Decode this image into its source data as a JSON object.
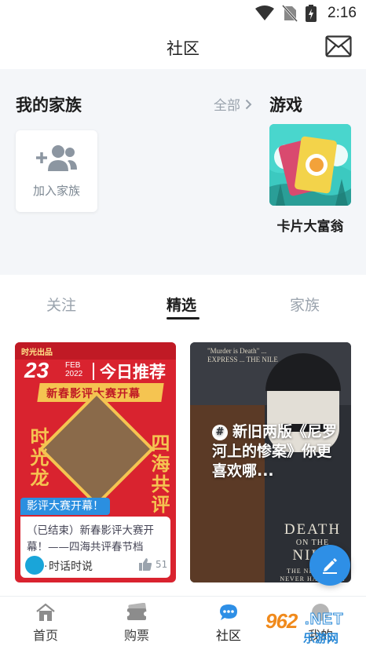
{
  "status_bar": {
    "time": "2:16"
  },
  "header": {
    "title": "社区"
  },
  "families": {
    "title": "我的家族",
    "see_all": "全部",
    "join_label": "加入家族"
  },
  "games": {
    "title": "游戏",
    "items": [
      {
        "name": "卡片大富翁"
      }
    ]
  },
  "tabs": [
    {
      "label": "关注"
    },
    {
      "label": "精选",
      "active": true
    },
    {
      "label": "家族"
    }
  ],
  "cards": [
    {
      "poster": {
        "brand": "时光出品",
        "day": "23",
        "month": "FEB",
        "year": "2022",
        "headline": "今日推荐",
        "banner": "新春影评大赛开幕",
        "side_left": "时光龙",
        "side_right": "四海共评"
      },
      "badge": "影评大赛开幕！",
      "desc": "（已结束）新春影评大赛开幕！——四海共评春节档 时...",
      "author": "时话时说",
      "likes": "51"
    },
    {
      "poster": {
        "small_text": "\"Murder is Death\" ... EXPRESS ... THE NILE",
        "tagline": "DEATH",
        "tagline2": "ON THE",
        "tagline3": "NILE",
        "subtag": "THE NILE HAS NEVER HAD SUCH DANGEROUS UNDERCURRENTS"
      },
      "overlay_title": "新旧两版《尼罗河上的惨案》你更喜欢哪..."
    }
  ],
  "bottom_nav": [
    {
      "label": "首页"
    },
    {
      "label": "购票"
    },
    {
      "label": "社区",
      "active": true
    },
    {
      "label": "我的"
    }
  ],
  "watermark": {
    "num": "962",
    "net": ".NET",
    "sub": "乐游网"
  },
  "colors": {
    "accent": "#2e8fe6",
    "badge": "#2b8fe0",
    "poster_red": "#d9232f"
  }
}
